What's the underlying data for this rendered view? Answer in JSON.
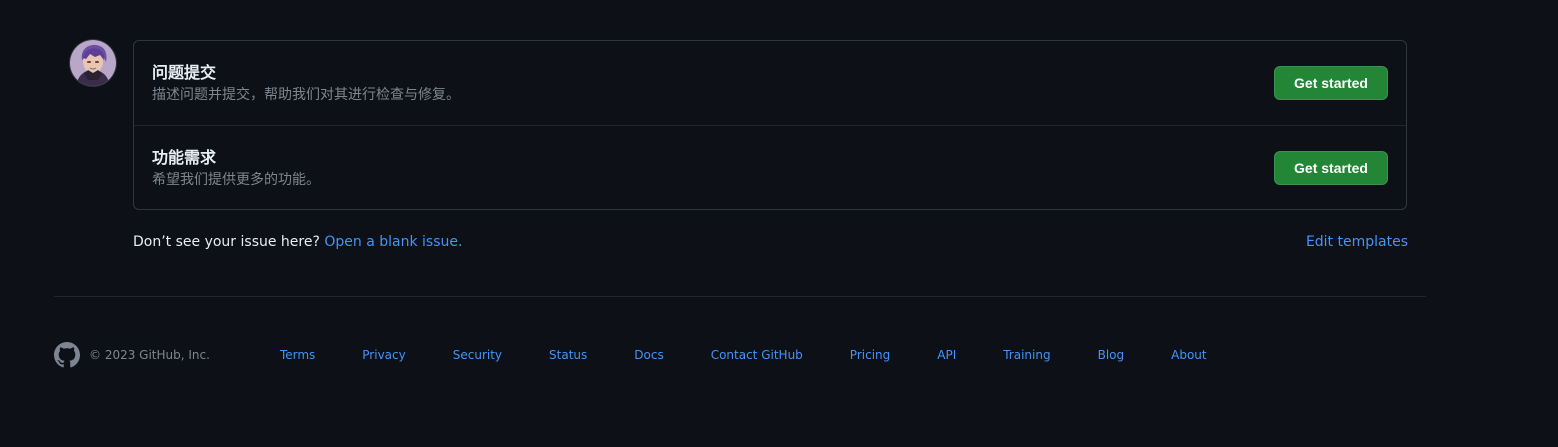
{
  "templates": [
    {
      "title": "问题提交",
      "description": "描述问题并提交，帮助我们对其进行检查与修复。",
      "button_label": "Get started"
    },
    {
      "title": "功能需求",
      "description": "希望我们提供更多的功能。",
      "button_label": "Get started"
    }
  ],
  "blank_issue": {
    "prompt": "Don’t see your issue here?",
    "link_label": "Open a blank issue."
  },
  "edit_templates_label": "Edit templates",
  "footer": {
    "copyright": "© 2023 GitHub, Inc.",
    "links": [
      "Terms",
      "Privacy",
      "Security",
      "Status",
      "Docs",
      "Contact GitHub",
      "Pricing",
      "API",
      "Training",
      "Blog",
      "About"
    ]
  },
  "colors": {
    "background": "#0d1117",
    "border": "#30363d",
    "button_green": "#238636",
    "link_blue": "#4493f8",
    "muted_text": "#7d8590"
  },
  "icons": {
    "avatar": "user-avatar",
    "footer_logo": "github-mark-icon"
  }
}
